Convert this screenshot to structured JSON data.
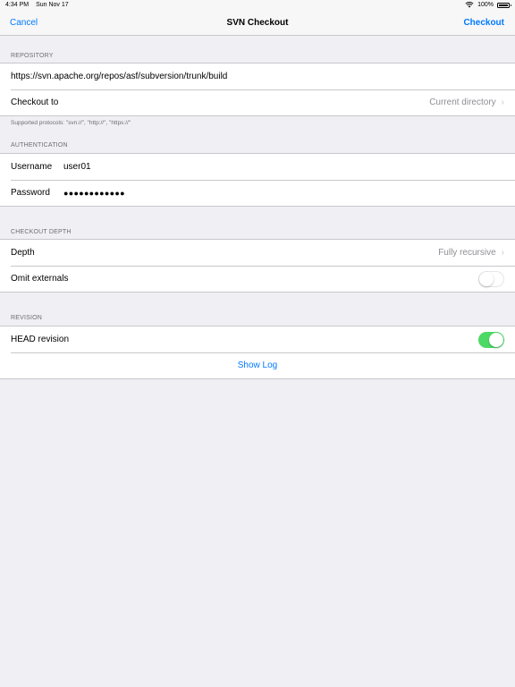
{
  "status": {
    "time": "4:34 PM",
    "date": "Sun Nov 17",
    "battery": "100%"
  },
  "nav": {
    "cancel": "Cancel",
    "title": "SVN Checkout",
    "checkout": "Checkout"
  },
  "repository": {
    "header": "REPOSITORY",
    "url": "https://svn.apache.org/repos/asf/subversion/trunk/build",
    "checkout_to_label": "Checkout to",
    "checkout_to_value": "Current directory",
    "note": "Supported protocols: \"svn://\", \"http://\", \"https://\""
  },
  "auth": {
    "header": "AUTHENTICATION",
    "username_label": "Username",
    "username_value": "user01",
    "password_label": "Password",
    "password_value": "●●●●●●●●●●●●"
  },
  "depth": {
    "header": "CHECKOUT DEPTH",
    "depth_label": "Depth",
    "depth_value": "Fully recursive",
    "omit_label": "Omit externals",
    "omit_on": false
  },
  "revision": {
    "header": "REVISION",
    "head_label": "HEAD revision",
    "head_on": true,
    "show_log": "Show Log"
  }
}
